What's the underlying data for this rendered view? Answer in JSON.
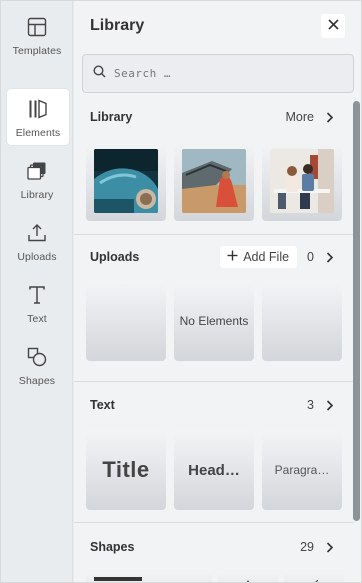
{
  "rail": {
    "items": [
      {
        "label": "Templates",
        "icon": "layout-icon"
      },
      {
        "label": "Elements",
        "icon": "elements-icon",
        "active": true
      },
      {
        "label": "Library",
        "icon": "library-icon"
      },
      {
        "label": "Uploads",
        "icon": "upload-icon"
      },
      {
        "label": "Text",
        "icon": "text-icon"
      },
      {
        "label": "Shapes",
        "icon": "shapes-icon"
      }
    ]
  },
  "panel": {
    "title": "Library",
    "search_placeholder": "Search …"
  },
  "library_section": {
    "title": "Library",
    "more_label": "More"
  },
  "uploads_section": {
    "title": "Uploads",
    "add_file_label": "Add File",
    "count": "0",
    "empty_label": "No Elements"
  },
  "text_section": {
    "title": "Text",
    "count": "3",
    "items": [
      "Title",
      "Head…",
      "Paragra…"
    ]
  },
  "shapes_section": {
    "title": "Shapes",
    "count": "29"
  },
  "colors": {
    "accent": "#333333",
    "rail_bg": "#e9ecef",
    "panel_bg": "#f2f3f5",
    "scrollbar": "#8e9399"
  }
}
